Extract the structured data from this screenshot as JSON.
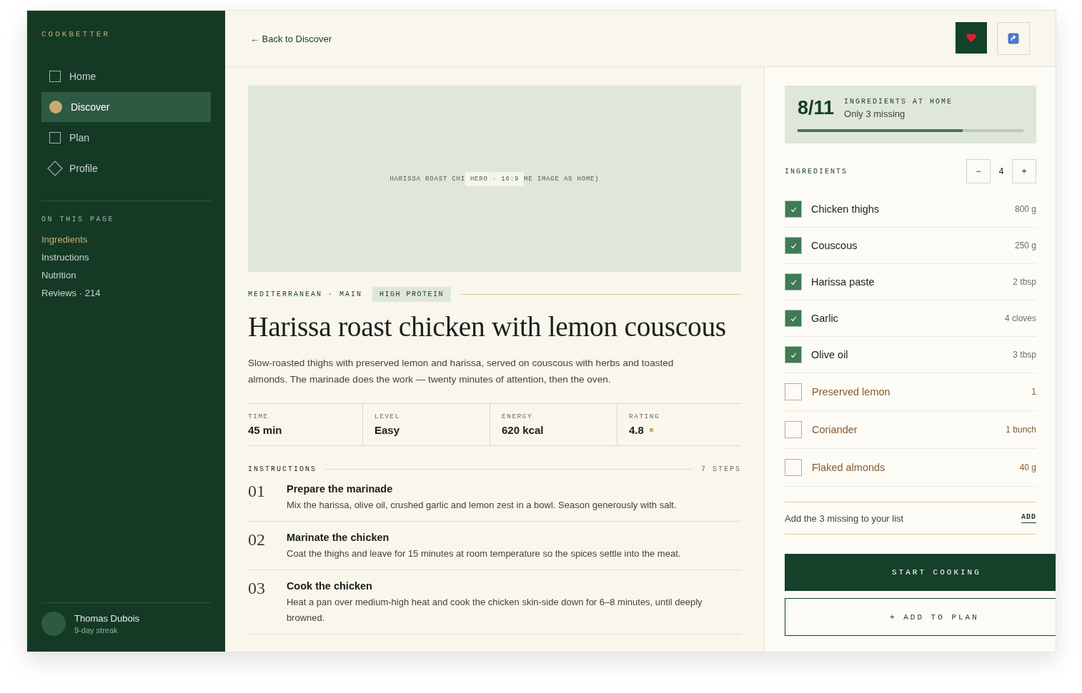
{
  "sidebar": {
    "brand": "COOKBETTER",
    "nav": [
      {
        "label": "Home",
        "kind": "page",
        "selected": false
      },
      {
        "label": "Discover",
        "kind": "page",
        "selected": true
      },
      {
        "label": "Plan",
        "kind": "page",
        "selected": false
      },
      {
        "label": "Profile",
        "kind": "account",
        "selected": false
      }
    ],
    "section_title": "ON THIS PAGE",
    "page_links": [
      {
        "label": "Ingredients",
        "selected": true
      },
      {
        "label": "Instructions",
        "selected": false
      },
      {
        "label": "Nutrition",
        "selected": false
      },
      {
        "label": "Reviews · 214",
        "selected": false
      }
    ],
    "user": {
      "name": "Thomas Dubois",
      "status": "9-day streak"
    }
  },
  "header": {
    "back_link": "← Back to Discover"
  },
  "hero": {
    "caption_start": "HARISSA ROAST CHI",
    "badge": "HERO · 16:9",
    "caption_end": "ME IMAGE AS HOME)"
  },
  "tags": {
    "category": "MEDITERRANEAN · MAIN",
    "badge": "HIGH PROTEIN"
  },
  "title": "Harissa roast chicken with lemon couscous",
  "description": "Slow-roasted thighs with preserved lemon and harissa, served on couscous with herbs and toasted almonds. The marinade does the work — twenty minutes of attention, then the oven.",
  "stats": [
    {
      "label": "TIME",
      "value": "45 min",
      "kind": "text"
    },
    {
      "label": "LEVEL",
      "value": "Easy",
      "kind": "text"
    },
    {
      "label": "ENERGY",
      "value": "620 kcal",
      "kind": "text"
    },
    {
      "label": "RATING",
      "value": "4.8",
      "kind": "rating"
    }
  ],
  "instructions": {
    "title": "INSTRUCTIONS",
    "count": "7 STEPS",
    "steps": [
      {
        "number": "01",
        "title": "Prepare the marinade",
        "text": "Mix the harissa, olive oil, crushed garlic and lemon zest in a bowl. Season generously with salt."
      },
      {
        "number": "02",
        "title": "Marinate the chicken",
        "text": "Coat the thighs and leave for 15 minutes at room temperature so the spices settle into the meat."
      },
      {
        "number": "03",
        "title": "Cook the chicken",
        "text": "Heat a pan over medium-high heat and cook the chicken skin-side down for 6–8 minutes, until deeply browned."
      }
    ]
  },
  "pantry": {
    "count": "8/11",
    "label": "INGREDIENTS AT HOME",
    "note": "Only 3 missing",
    "level": 0.73
  },
  "ingredients": {
    "title": "INGREDIENTS",
    "decrease": "−",
    "servings": "4",
    "increase": "+",
    "items": [
      {
        "name": "Chicken thighs",
        "amount": "800 g",
        "checked": true
      },
      {
        "name": "Couscous",
        "amount": "250 g",
        "checked": true
      },
      {
        "name": "Harissa paste",
        "amount": "2 tbsp",
        "checked": true
      },
      {
        "name": "Garlic",
        "amount": "4 cloves",
        "checked": true
      },
      {
        "name": "Olive oil",
        "amount": "3 tbsp",
        "checked": true
      },
      {
        "name": "Preserved lemon",
        "amount": "1",
        "checked": false
      },
      {
        "name": "Coriander",
        "amount": "1 bunch",
        "checked": false
      },
      {
        "name": "Flaked almonds",
        "amount": "40 g",
        "checked": false
      }
    ]
  },
  "shopping": {
    "text": "Add the 3 missing to your list",
    "action": "ADD"
  },
  "actions": {
    "primary": "START COOKING",
    "secondary": "+ ADD TO PLAN"
  }
}
